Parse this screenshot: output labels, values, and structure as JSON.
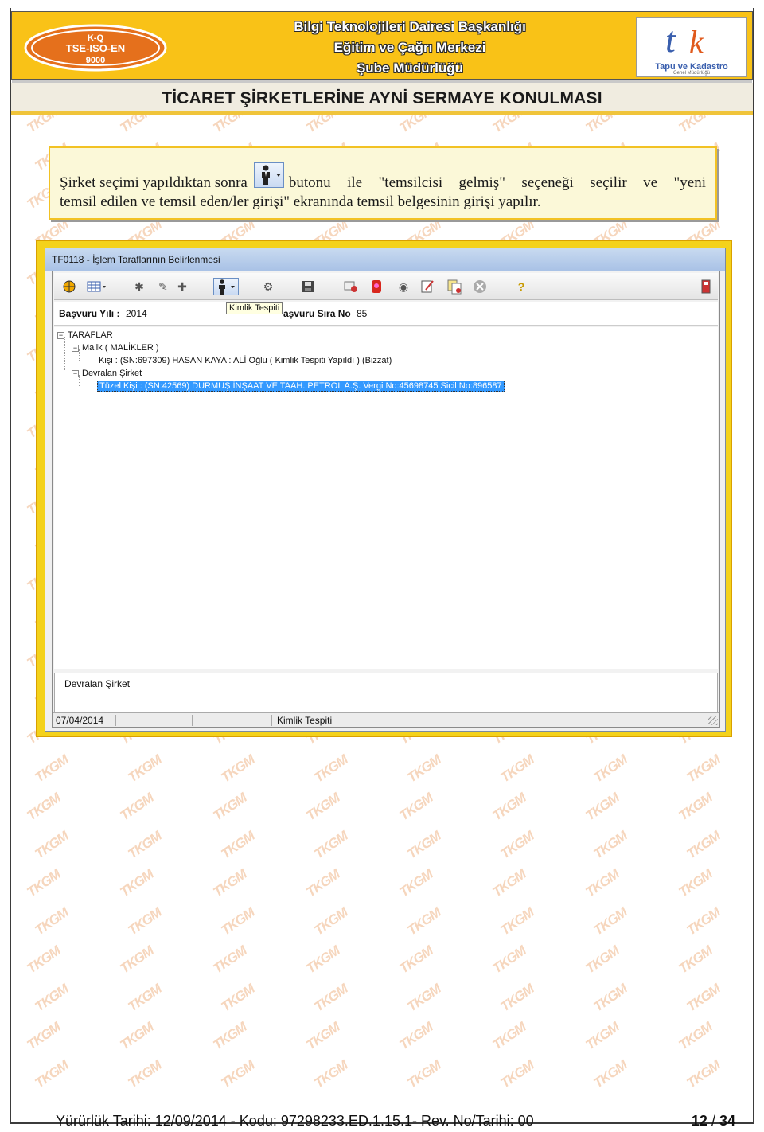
{
  "header": {
    "badge_text": [
      "K-Q",
      "TSE-ISO-EN",
      "9000"
    ],
    "titles": [
      "Bilgi Teknolojileri Dairesi Başkanlığı",
      "Eğitim ve Çağrı Merkezi",
      "Şube Müdürlüğü"
    ],
    "logo_name": "Tapu ve Kadastro",
    "logo_sub": "Genel Müdürlüğü"
  },
  "subject": "TİCARET ŞİRKETLERİNE AYNİ SERMAYE KONULMASI",
  "note": {
    "before_button": "Şirket seçimi yapıldıktan sonra",
    "after_button": "butonu ile \"temsilcisi gelmiş\" seçeneği seçilir ve \"yeni",
    "line2": "temsil edilen ve temsil eden/ler girişi\" ekranında temsil belgesinin girişi yapılır."
  },
  "window": {
    "title": "TF0118 - İşlem Taraflarının Belirlenmesi",
    "tooltip": "Kimlik Tespiti",
    "basvuru_yili_label": "Başvuru Yılı :",
    "basvuru_yili_value": "2014",
    "sira_no_label": "aşvuru Sıra No",
    "sira_no_value": "85",
    "tree": {
      "root": "TARAFLAR",
      "malik": "Malik ( MALİKLER )",
      "kisi": "Kişi : (SN:697309) HASAN KAYA : ALİ Oğlu ( Kimlik Tespiti Yapıldı ) (Bizzat)",
      "devralan": "Devralan Şirket",
      "tuzel": "Tüzel Kişi : (SN:42569) DURMUŞ İNŞAAT VE TAAH. PETROL A.Ş. Vergi No:45698745 Sicil No:896587"
    },
    "description": "Devralan Şirket",
    "status_date": "07/04/2014",
    "status_text": "Kimlik Tespiti"
  },
  "footer": {
    "left": "Yürürlük Tarihi:  12/09/2014  -  Kodu:  97298233.ED.1.15.1-  Rev. No/Tarihi: 00",
    "page_current": "12",
    "page_sep": " / ",
    "page_total": "34"
  },
  "colors": {
    "header_yellow": "#f9c217",
    "frame_yellow": "#f4d21b",
    "badge_orange": "#e5701c",
    "selection_blue": "#3399ff"
  }
}
